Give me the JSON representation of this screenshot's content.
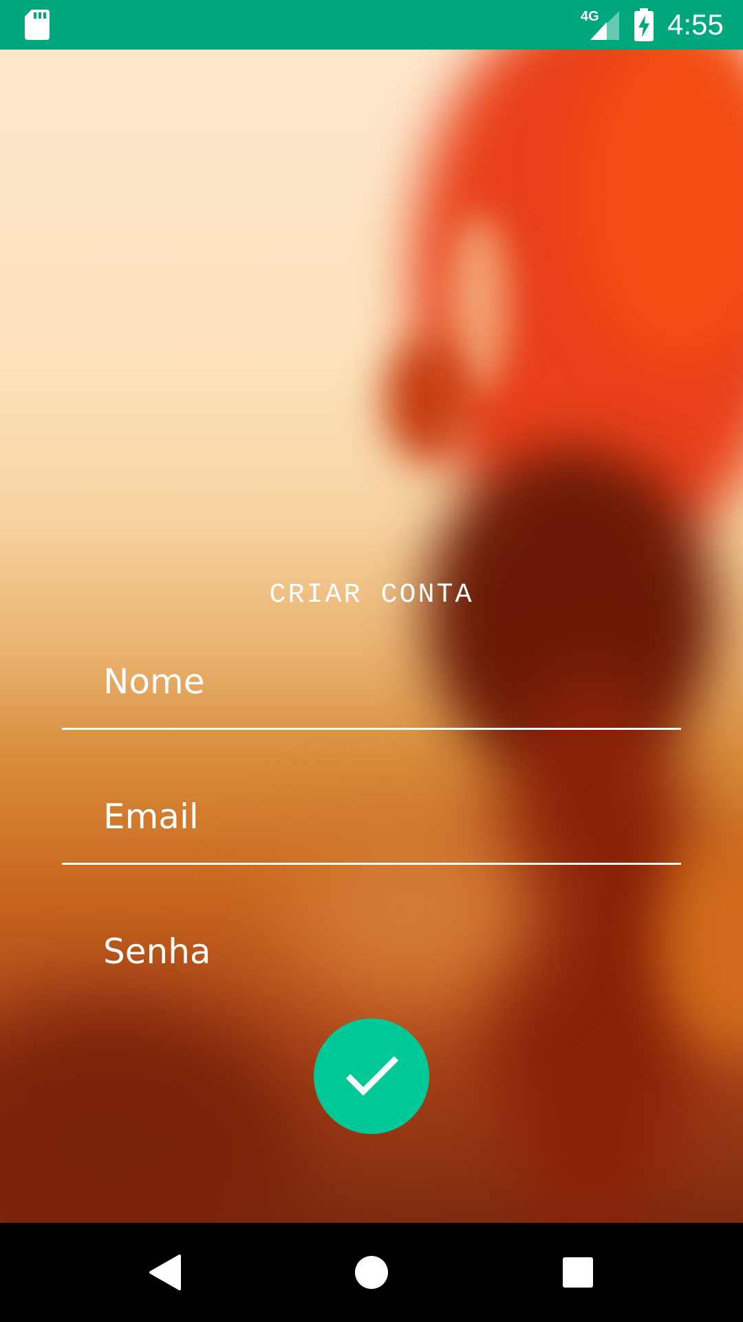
{
  "status_bar": {
    "time": "4:55",
    "network": "4G",
    "icons": [
      "sd-card-icon",
      "signal-icon",
      "battery-charging-icon"
    ],
    "color": "#00a77d"
  },
  "form": {
    "title": "CRIAR CONTA",
    "name_placeholder": "Nome",
    "email_placeholder": "Email",
    "password_placeholder": "Senha",
    "confirm_icon": "check-icon",
    "confirm_color": "#00c896"
  },
  "nav_bar": {
    "icons": [
      "back-icon",
      "home-icon",
      "recents-icon"
    ]
  }
}
